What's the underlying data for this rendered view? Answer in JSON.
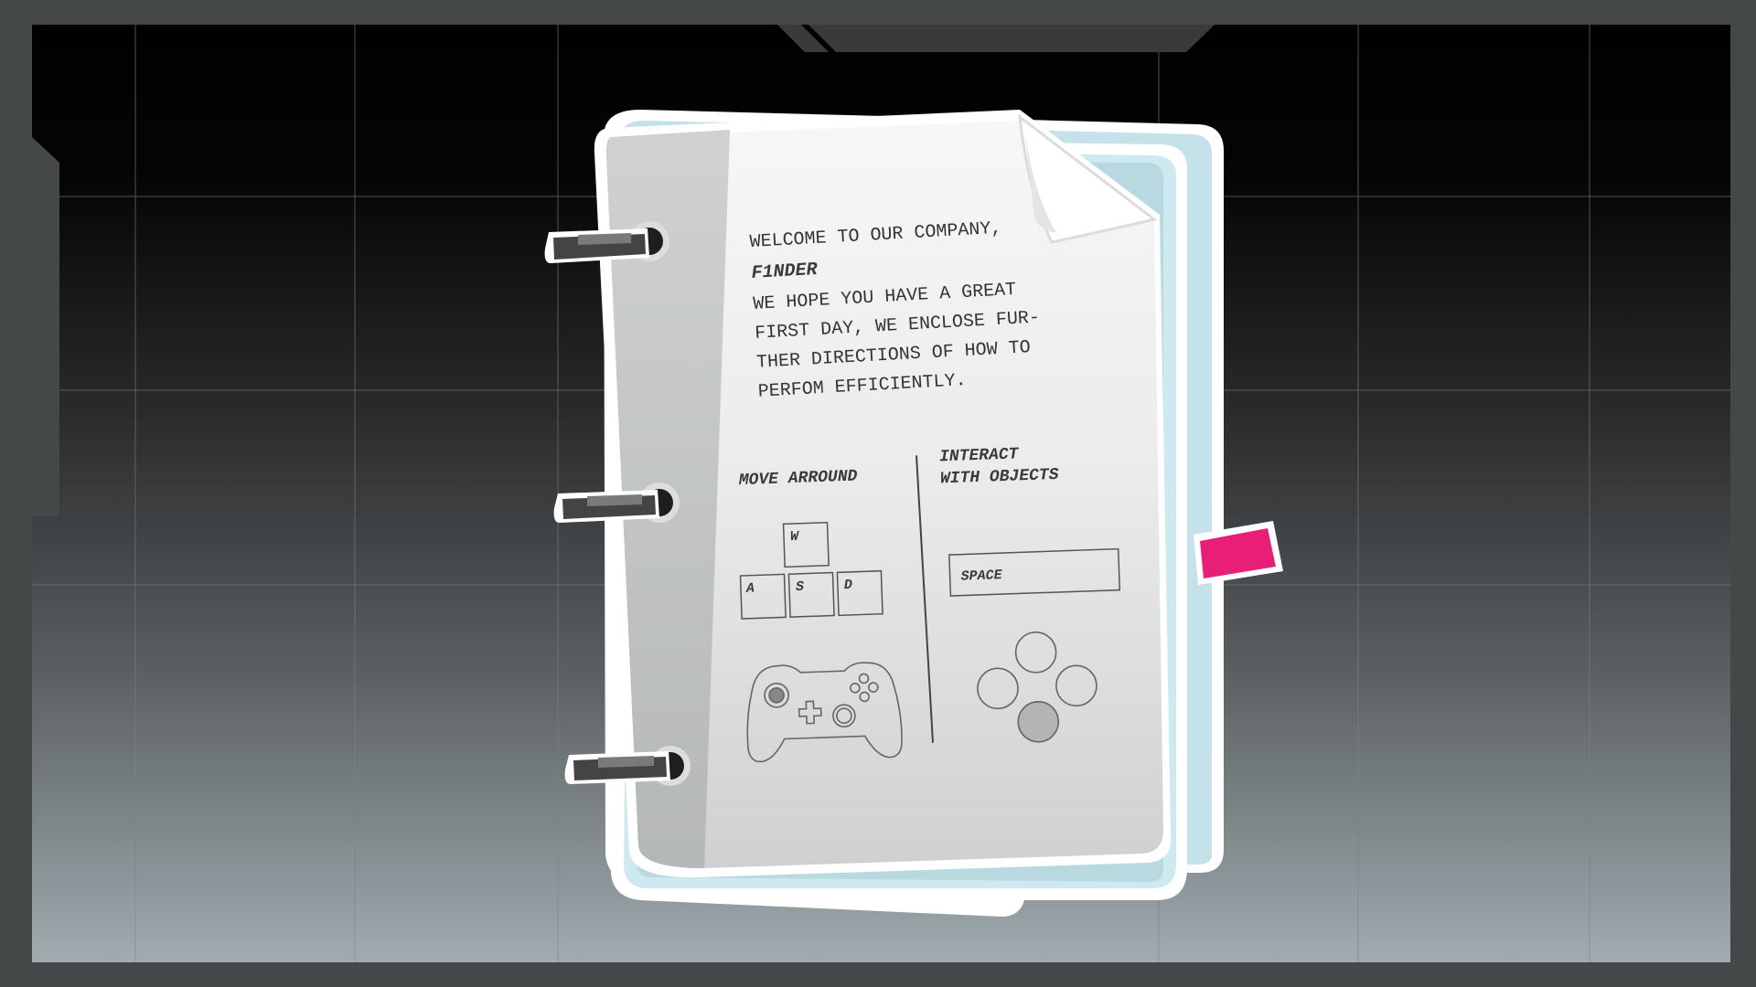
{
  "letter": {
    "line1": "WELCOME TO OUR COMPANY,",
    "name": "F1NDER",
    "body": [
      "WE HOPE YOU HAVE A GREAT",
      "FIRST DAY, WE ENCLOSE FUR-",
      "THER DIRECTIONS OF HOW TO",
      "PERFOM EFFICIENTLY."
    ]
  },
  "controls": {
    "move_title": "MOVE ARROUND",
    "interact_title_1": "INTERACT",
    "interact_title_2": "WITH OBJECTS",
    "keys": {
      "w": "W",
      "a": "A",
      "s": "S",
      "d": "D"
    },
    "space_key": "SPACE"
  },
  "icons": {
    "movement_gamepad": "gamepad-icon",
    "interact_buttons": "face-buttons-icon"
  },
  "colors": {
    "bookmark": "#e91e77",
    "cover": "#d7eef6",
    "paper": "#f3f4f5",
    "frame": "#3a3a3a"
  }
}
